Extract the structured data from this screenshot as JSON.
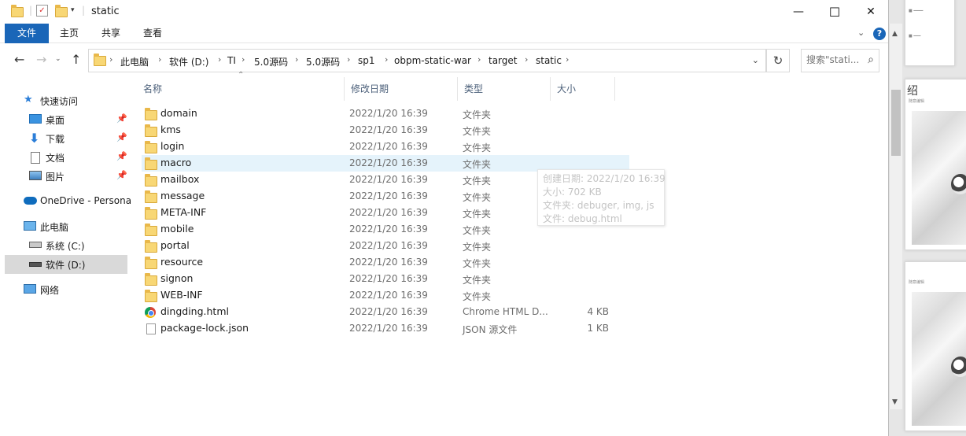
{
  "window": {
    "title": "static",
    "controls": {
      "minimize": "—",
      "maximize": "☐",
      "close": "✕"
    }
  },
  "ribbon": {
    "tabs": [
      "文件",
      "主页",
      "共享",
      "查看"
    ],
    "help_icon": "?"
  },
  "address_bar": {
    "crumbs": [
      "此电脑",
      "软件 (D:)",
      "TI",
      "5.0源码",
      "5.0源码",
      "sp1",
      "obpm-static-war",
      "target",
      "static"
    ]
  },
  "search": {
    "placeholder": "搜索\"stati..."
  },
  "nav_pane": {
    "items": [
      {
        "label": "快速访问",
        "icon": "star-icon",
        "pinned": false
      },
      {
        "label": "桌面",
        "icon": "desktop-icon",
        "pinned": true
      },
      {
        "label": "下载",
        "icon": "download-icon",
        "pinned": true
      },
      {
        "label": "文档",
        "icon": "document-icon",
        "pinned": true
      },
      {
        "label": "图片",
        "icon": "pictures-icon",
        "pinned": true
      },
      {
        "label": "OneDrive - Persona",
        "icon": "cloud-icon",
        "pinned": false
      },
      {
        "label": "此电脑",
        "icon": "computer-icon",
        "pinned": false
      },
      {
        "label": "系统 (C:)",
        "icon": "drive-icon",
        "pinned": false
      },
      {
        "label": "软件 (D:)",
        "icon": "drive-icon",
        "pinned": false,
        "selected": true
      },
      {
        "label": "网络",
        "icon": "network-icon",
        "pinned": false
      }
    ]
  },
  "columns": {
    "name": "名称",
    "date": "修改日期",
    "type": "类型",
    "size": "大小"
  },
  "files": [
    {
      "name": "domain",
      "date": "2022/1/20 16:39",
      "type": "文件夹",
      "size": "",
      "icon": "folder-icon"
    },
    {
      "name": "kms",
      "date": "2022/1/20 16:39",
      "type": "文件夹",
      "size": "",
      "icon": "folder-icon"
    },
    {
      "name": "login",
      "date": "2022/1/20 16:39",
      "type": "文件夹",
      "size": "",
      "icon": "folder-icon"
    },
    {
      "name": "macro",
      "date": "2022/1/20 16:39",
      "type": "文件夹",
      "size": "",
      "icon": "folder-icon",
      "hover": true
    },
    {
      "name": "mailbox",
      "date": "2022/1/20 16:39",
      "type": "文件夹",
      "size": "",
      "icon": "folder-icon"
    },
    {
      "name": "message",
      "date": "2022/1/20 16:39",
      "type": "文件夹",
      "size": "",
      "icon": "folder-icon"
    },
    {
      "name": "META-INF",
      "date": "2022/1/20 16:39",
      "type": "文件夹",
      "size": "",
      "icon": "folder-icon"
    },
    {
      "name": "mobile",
      "date": "2022/1/20 16:39",
      "type": "文件夹",
      "size": "",
      "icon": "folder-icon"
    },
    {
      "name": "portal",
      "date": "2022/1/20 16:39",
      "type": "文件夹",
      "size": "",
      "icon": "folder-icon"
    },
    {
      "name": "resource",
      "date": "2022/1/20 16:39",
      "type": "文件夹",
      "size": "",
      "icon": "folder-icon"
    },
    {
      "name": "signon",
      "date": "2022/1/20 16:39",
      "type": "文件夹",
      "size": "",
      "icon": "folder-icon"
    },
    {
      "name": "WEB-INF",
      "date": "2022/1/20 16:39",
      "type": "文件夹",
      "size": "",
      "icon": "folder-icon"
    },
    {
      "name": "dingding.html",
      "date": "2022/1/20 16:39",
      "type": "Chrome HTML D...",
      "size": "4 KB",
      "icon": "chrome-icon"
    },
    {
      "name": "package-lock.json",
      "date": "2022/1/20 16:39",
      "type": "JSON 源文件",
      "size": "1 KB",
      "icon": "json-file-icon"
    }
  ],
  "tooltip": {
    "lines": [
      "创建日期: 2022/1/20 16:39",
      "大小: 702 KB",
      "文件夹: debuger, img, js",
      "文件: debug.html"
    ]
  },
  "background_doc": {
    "heading_char": "绍",
    "caption": "随意编辑"
  },
  "colors": {
    "accent": "#1a66b8",
    "selected": "#d9d9d9",
    "hover": "#e5f3fb",
    "folder": "#f8d775"
  }
}
